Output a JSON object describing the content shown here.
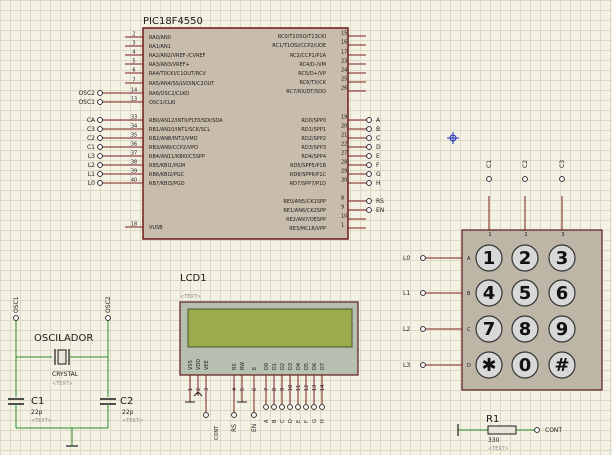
{
  "mcu": {
    "name": "PIC18F4550",
    "left_pins": [
      {
        "num": "2",
        "label": "RA0/AN0"
      },
      {
        "num": "3",
        "label": "RA1/AN1"
      },
      {
        "num": "4",
        "label": "RA2/AN2/VREF-/CVREF"
      },
      {
        "num": "5",
        "label": "RA3/AN3/VREF+"
      },
      {
        "num": "6",
        "label": "RA4/T0CKI/C1OUT/RCV"
      },
      {
        "num": "7",
        "label": "RA5/AN4/SS/LVDIN/C2OUT"
      },
      {
        "num": "14",
        "label": "RA6/OSC2/CLKO",
        "net": "OSC2"
      },
      {
        "num": "13",
        "label": "OSC1/CLKI",
        "net": "OSC1"
      },
      {
        "num": "33",
        "label": "RB0/AN12/INT0/FLT0/SDI/SDA",
        "net": "CA"
      },
      {
        "num": "34",
        "label": "RB1/AN10/INT1/SCK/SCL",
        "net": "C3"
      },
      {
        "num": "35",
        "label": "RB2/AN8/INT2/VMO",
        "net": "C2"
      },
      {
        "num": "36",
        "label": "RB3/AN9/CCP2/VPO",
        "net": "C1"
      },
      {
        "num": "37",
        "label": "RB4/AN11/KBI0/CSSPP",
        "net": "L3"
      },
      {
        "num": "38",
        "label": "RB5/KBI1/PGM",
        "net": "L2"
      },
      {
        "num": "39",
        "label": "RB6/KBI2/PGC",
        "net": "L1"
      },
      {
        "num": "40",
        "label": "RB7/KBI3/PGD",
        "net": "L0"
      },
      {
        "num": "18",
        "label": "VUSB"
      }
    ],
    "right_pins": [
      {
        "num": "15",
        "label": "RC0/T1OSO/T13CKI"
      },
      {
        "num": "16",
        "label": "RC1/T1OSI/CCP2/UOE"
      },
      {
        "num": "17",
        "label": "RC2/CCP1/P1A"
      },
      {
        "num": "23",
        "label": "RC4/D-/VM"
      },
      {
        "num": "24",
        "label": "RC5/D+/VP"
      },
      {
        "num": "25",
        "label": "RC6/TX/CK"
      },
      {
        "num": "26",
        "label": "RC7/RX/DT/SDO"
      },
      {
        "num": "19",
        "label": "RD0/SPP0",
        "net": "A"
      },
      {
        "num": "20",
        "label": "RD1/SPP1",
        "net": "B"
      },
      {
        "num": "21",
        "label": "RD2/SPP2",
        "net": "C"
      },
      {
        "num": "22",
        "label": "RD3/SPP3",
        "net": "D"
      },
      {
        "num": "27",
        "label": "RD4/SPP4",
        "net": "E"
      },
      {
        "num": "28",
        "label": "RD5/SPP5/P1B",
        "net": "F"
      },
      {
        "num": "29",
        "label": "RD6/SPP6/P1C",
        "net": "G"
      },
      {
        "num": "30",
        "label": "RD7/SPP7/P1D",
        "net": "H"
      },
      {
        "num": "8",
        "label": "RE0/AN5/CK1SPP",
        "net": "RS"
      },
      {
        "num": "9",
        "label": "RE1/AN6/CK2SPP",
        "net": "EN"
      },
      {
        "num": "10",
        "label": "RE2/AN7/OESPP"
      },
      {
        "num": "1",
        "label": "RE3/MCLR/VPP"
      }
    ]
  },
  "lcd": {
    "name": "LCD1",
    "text_tag": "<TEXT>",
    "pin_labels": [
      "VSS",
      "VDD",
      "VEE",
      "RS",
      "RW",
      "E",
      "D0",
      "D1",
      "D2",
      "D3",
      "D4",
      "D5",
      "D6",
      "D7"
    ],
    "pin_numbers": [
      "1",
      "2",
      "3",
      "4",
      "5",
      "6",
      "7",
      "8",
      "9",
      "10",
      "11",
      "12",
      "13",
      "14"
    ],
    "net_labels": {
      "cont": "CONT",
      "rs": "RS",
      "en": "EN"
    },
    "bottom_nets": [
      "A",
      "B",
      "C",
      "D",
      "E",
      "F",
      "G",
      "H"
    ]
  },
  "keypad": {
    "keys": [
      "1",
      "2",
      "3",
      "4",
      "5",
      "6",
      "7",
      "8",
      "9",
      "✱",
      "0",
      "#"
    ],
    "row_letters": [
      "A",
      "B",
      "C",
      "D"
    ],
    "col_numbers": [
      "1",
      "2",
      "3"
    ],
    "row_nets": [
      "L0",
      "L1",
      "L2",
      "L3"
    ],
    "col_nets": [
      "C1",
      "C2",
      "C3"
    ]
  },
  "oscillator": {
    "title": "OSCILADOR",
    "crystal_label": "CRYSTAL",
    "text_tag": "<TEXT>",
    "net_left": "OSC1",
    "net_right": "OSC2",
    "c1": {
      "name": "C1",
      "value": "22p"
    },
    "c2": {
      "name": "C2",
      "value": "22p"
    }
  },
  "resistor": {
    "name": "R1",
    "value": "330",
    "text_tag": "<TEXT>",
    "net": "CONT"
  }
}
